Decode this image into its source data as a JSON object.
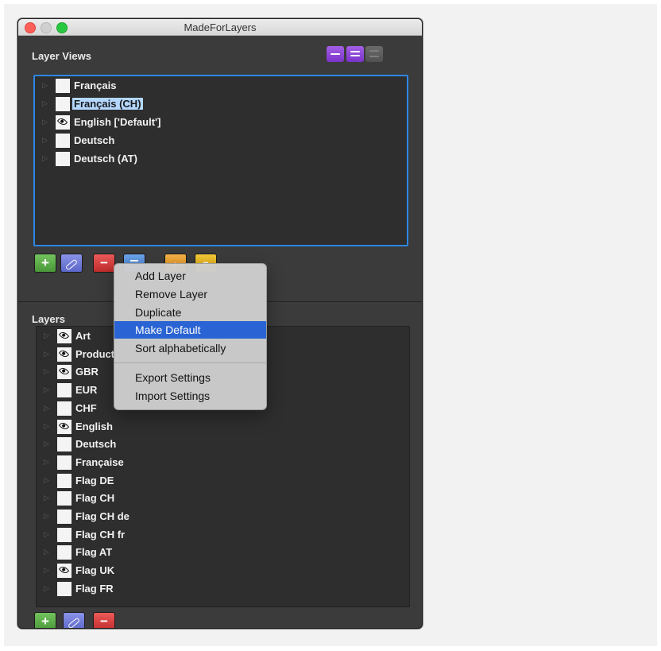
{
  "window": {
    "title": "MadeForLayers"
  },
  "layer_views": {
    "title": "Layer Views",
    "rows": [
      {
        "label": "Français",
        "visible": false,
        "selected": false
      },
      {
        "label": "Français (CH)",
        "visible": false,
        "selected": true
      },
      {
        "label": "English ['Default']",
        "visible": true,
        "selected": false
      },
      {
        "label": "Deutsch",
        "visible": false,
        "selected": false
      },
      {
        "label": "Deutsch (AT)",
        "visible": false,
        "selected": false
      }
    ]
  },
  "layers": {
    "title": "Layers",
    "rows": [
      {
        "label": "Art",
        "visible": true
      },
      {
        "label": "Product",
        "visible": true
      },
      {
        "label": "GBR",
        "visible": true
      },
      {
        "label": "EUR",
        "visible": false
      },
      {
        "label": "CHF",
        "visible": false
      },
      {
        "label": "English",
        "visible": true
      },
      {
        "label": "Deutsch",
        "visible": false
      },
      {
        "label": "Française",
        "visible": false
      },
      {
        "label": "Flag DE",
        "visible": false
      },
      {
        "label": "Flag CH",
        "visible": false
      },
      {
        "label": "Flag CH de",
        "visible": false
      },
      {
        "label": "Flag CH fr",
        "visible": false
      },
      {
        "label": "Flag AT",
        "visible": false
      },
      {
        "label": "Flag UK",
        "visible": true
      },
      {
        "label": "Flag FR",
        "visible": false
      }
    ]
  },
  "context_menu": {
    "items": [
      "Add Layer",
      "Remove Layer",
      "Duplicate",
      "Make Default",
      "Sort alphabetically"
    ],
    "items2": [
      "Export Settings",
      "Import Settings"
    ],
    "highlighted": "Make Default"
  },
  "buttons": {
    "add": "+",
    "remove": "−",
    "add2": "+",
    "remove2": "−"
  },
  "icons": {
    "add": "plus-icon",
    "edit": "pencil-icon",
    "remove": "minus-icon",
    "menu": "menu-icon",
    "up": "arrow-up-icon",
    "down": "arrow-down-icon",
    "visibility": "eye-icon",
    "disclosure": "disclosure-triangle-icon"
  },
  "colors": {
    "selection_border": "#2d86e4",
    "menu_highlight": "#2a63d3"
  }
}
